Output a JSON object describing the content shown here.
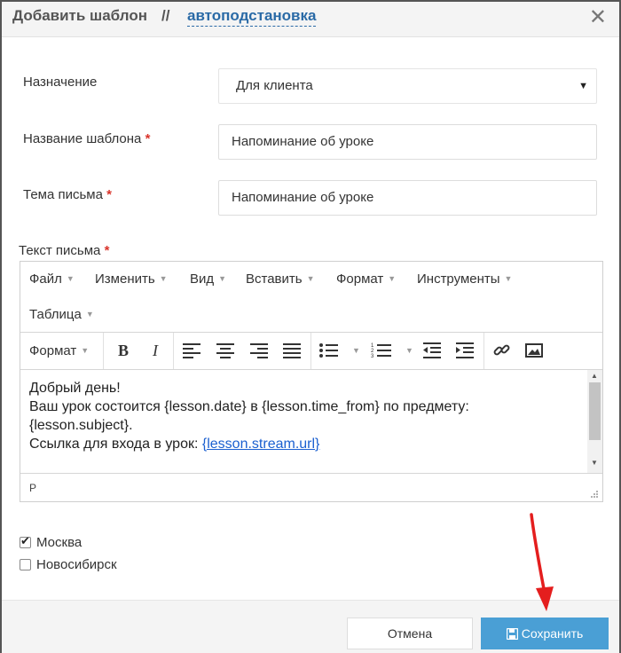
{
  "header": {
    "title": "Добавить шаблон",
    "separator": "//",
    "link": "автоподстановка",
    "close_icon": "close-icon"
  },
  "form": {
    "purpose": {
      "label": "Назначение",
      "value": "Для клиента"
    },
    "template_name": {
      "label": "Название шаблона",
      "required_mark": "*",
      "value": "Напоминание об уроке"
    },
    "subject": {
      "label": "Тема письма",
      "required_mark": "*",
      "value": "Напоминание об уроке"
    },
    "body_label": "Текст письма",
    "body_required_mark": "*"
  },
  "editor": {
    "menu": [
      "Файл",
      "Изменить",
      "Вид",
      "Вставить",
      "Формат",
      "Инструменты",
      "Таблица"
    ],
    "toolbar": {
      "format_label": "Формат",
      "icons": [
        "bold-icon",
        "italic-icon",
        "align-left-icon",
        "align-center-icon",
        "align-right-icon",
        "align-justify-icon",
        "bullet-list-icon",
        "numbered-list-icon",
        "outdent-icon",
        "indent-icon",
        "link-icon",
        "image-icon"
      ]
    },
    "content": {
      "line1": "Добрый день!",
      "line2": "Ваш урок состоится {lesson.date} в {lesson.time_from} по предмету:",
      "line3": "{lesson.subject}.",
      "line4_text": "Ссылка для входа в урок: ",
      "line4_link": "{lesson.stream.url}"
    },
    "status_path": "P"
  },
  "cities": [
    {
      "label": "Москва",
      "checked": true
    },
    {
      "label": "Новосибирск",
      "checked": false
    }
  ],
  "footer": {
    "cancel_label": "Отмена",
    "save_label": "Сохранить",
    "save_icon": "floppy-disk-icon"
  },
  "colors": {
    "accent": "#4a9fd5",
    "link": "#2a6aa6",
    "required": "#d9342b",
    "annotation_arrow": "#e41e1e"
  }
}
